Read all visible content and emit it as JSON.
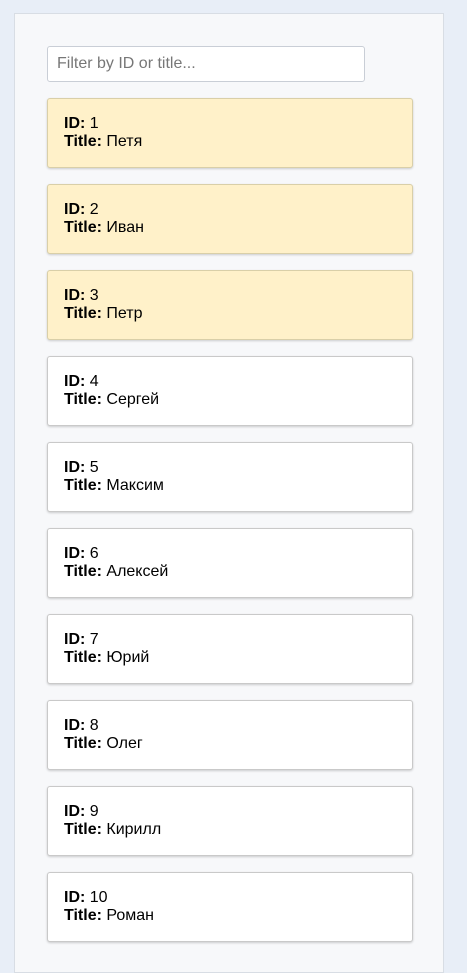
{
  "filter": {
    "placeholder": "Filter by ID or title...",
    "value": ""
  },
  "labels": {
    "id": "ID:",
    "title": "Title:"
  },
  "colors": {
    "highlight": "#fff1c9",
    "card": "#ffffff"
  },
  "items": [
    {
      "id": "1",
      "title": "Петя",
      "highlighted": true
    },
    {
      "id": "2",
      "title": "Иван",
      "highlighted": true
    },
    {
      "id": "3",
      "title": "Петр",
      "highlighted": true
    },
    {
      "id": "4",
      "title": "Сергей",
      "highlighted": false
    },
    {
      "id": "5",
      "title": "Максим",
      "highlighted": false
    },
    {
      "id": "6",
      "title": "Алексей",
      "highlighted": false
    },
    {
      "id": "7",
      "title": "Юрий",
      "highlighted": false
    },
    {
      "id": "8",
      "title": "Олег",
      "highlighted": false
    },
    {
      "id": "9",
      "title": "Кирилл",
      "highlighted": false
    },
    {
      "id": "10",
      "title": "Роман",
      "highlighted": false
    }
  ]
}
